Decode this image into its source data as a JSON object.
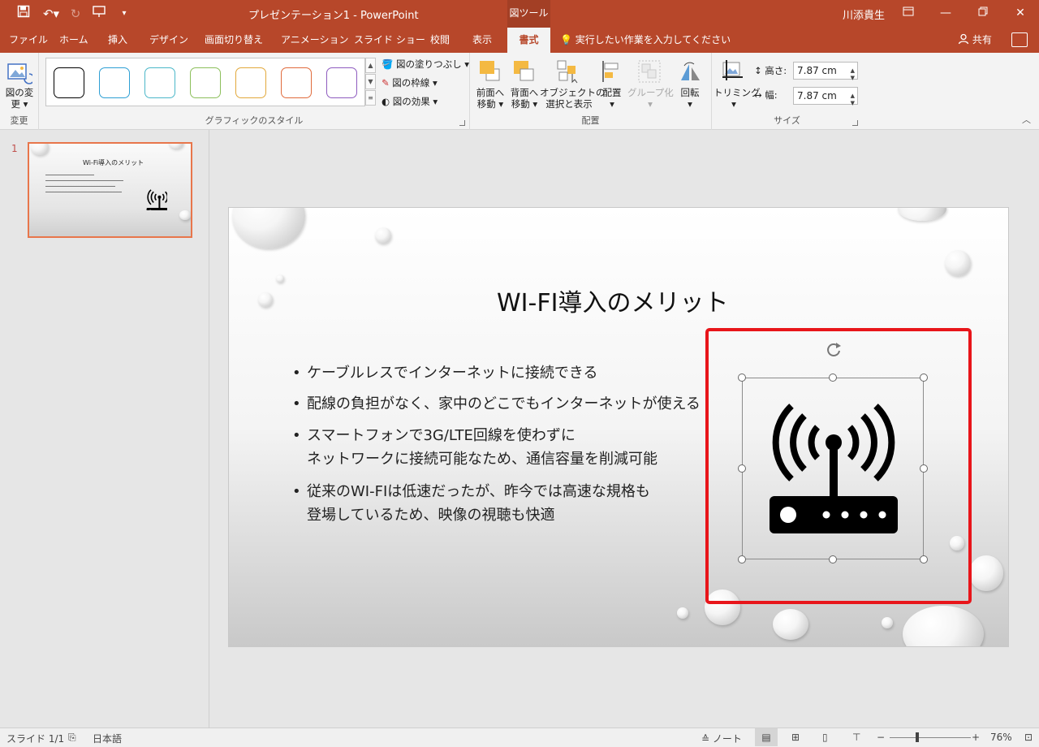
{
  "window": {
    "doc_title": "プレゼンテーション1 - PowerPoint",
    "context_tool": "図ツール",
    "user_name": "川添貴生"
  },
  "tabs": [
    {
      "label": "ファイル"
    },
    {
      "label": "ホーム"
    },
    {
      "label": "挿入"
    },
    {
      "label": "デザイン"
    },
    {
      "label": "画面切り替え"
    },
    {
      "label": "アニメーション"
    },
    {
      "label": "スライド ショー"
    },
    {
      "label": "校閲"
    },
    {
      "label": "表示"
    },
    {
      "label": "書式",
      "active": true
    }
  ],
  "tell_me": "実行したい作業を入力してください",
  "share_label": "共有",
  "ribbon": {
    "change_group": {
      "button": "図の変更",
      "button_line1": "図の変",
      "button_line2": "更",
      "group_name": "変更"
    },
    "styles_group": {
      "group_name": "グラフィックのスタイル",
      "fill": "図の塗りつぶし",
      "outline": "図の枠線",
      "effects": "図の効果",
      "style_colors": [
        "#000000",
        "#2e9fd4",
        "#4bb7c9",
        "#8cbf5b",
        "#e2a83b",
        "#e06b3c",
        "#8e5bbf"
      ]
    },
    "arrange_group": {
      "group_name": "配置",
      "bring_forward": [
        "前面へ",
        "移動"
      ],
      "send_backward": [
        "背面へ",
        "移動"
      ],
      "selection_pane": [
        "オブジェクトの",
        "選択と表示"
      ],
      "align": "配置",
      "group": "グループ化",
      "rotate": "回転"
    },
    "size_group": {
      "group_name": "サイズ",
      "crop": "トリミング",
      "height_label": "高さ:",
      "height_value": "7.87 cm",
      "width_label": "幅:",
      "width_value": "7.87 cm"
    }
  },
  "thumb": {
    "number": "1",
    "title": "Wi-Fi導入のメリット"
  },
  "slide": {
    "title": "WI-FI導入のメリット",
    "bullets": [
      [
        "ケーブルレスでインターネットに接続できる"
      ],
      [
        "配線の負担がなく、家中のどこでもインターネットが使える"
      ],
      [
        "スマートフォンで3G/LTE回線を使わずに",
        "ネットワークに接続可能なため、通信容量を削減可能"
      ],
      [
        "従来のWI-FIは低速だったが、昨今では高速な規格も",
        "登場しているため、映像の視聴も快適"
      ]
    ],
    "bullet_char": "•",
    "picture_icon": "wifi-router-icon"
  },
  "status": {
    "slide_info": "スライド 1/1",
    "language": "日本語",
    "notes": "ノート",
    "zoom": "76%"
  },
  "accent_color": "#b7472a",
  "highlight_color": "#e8151a"
}
